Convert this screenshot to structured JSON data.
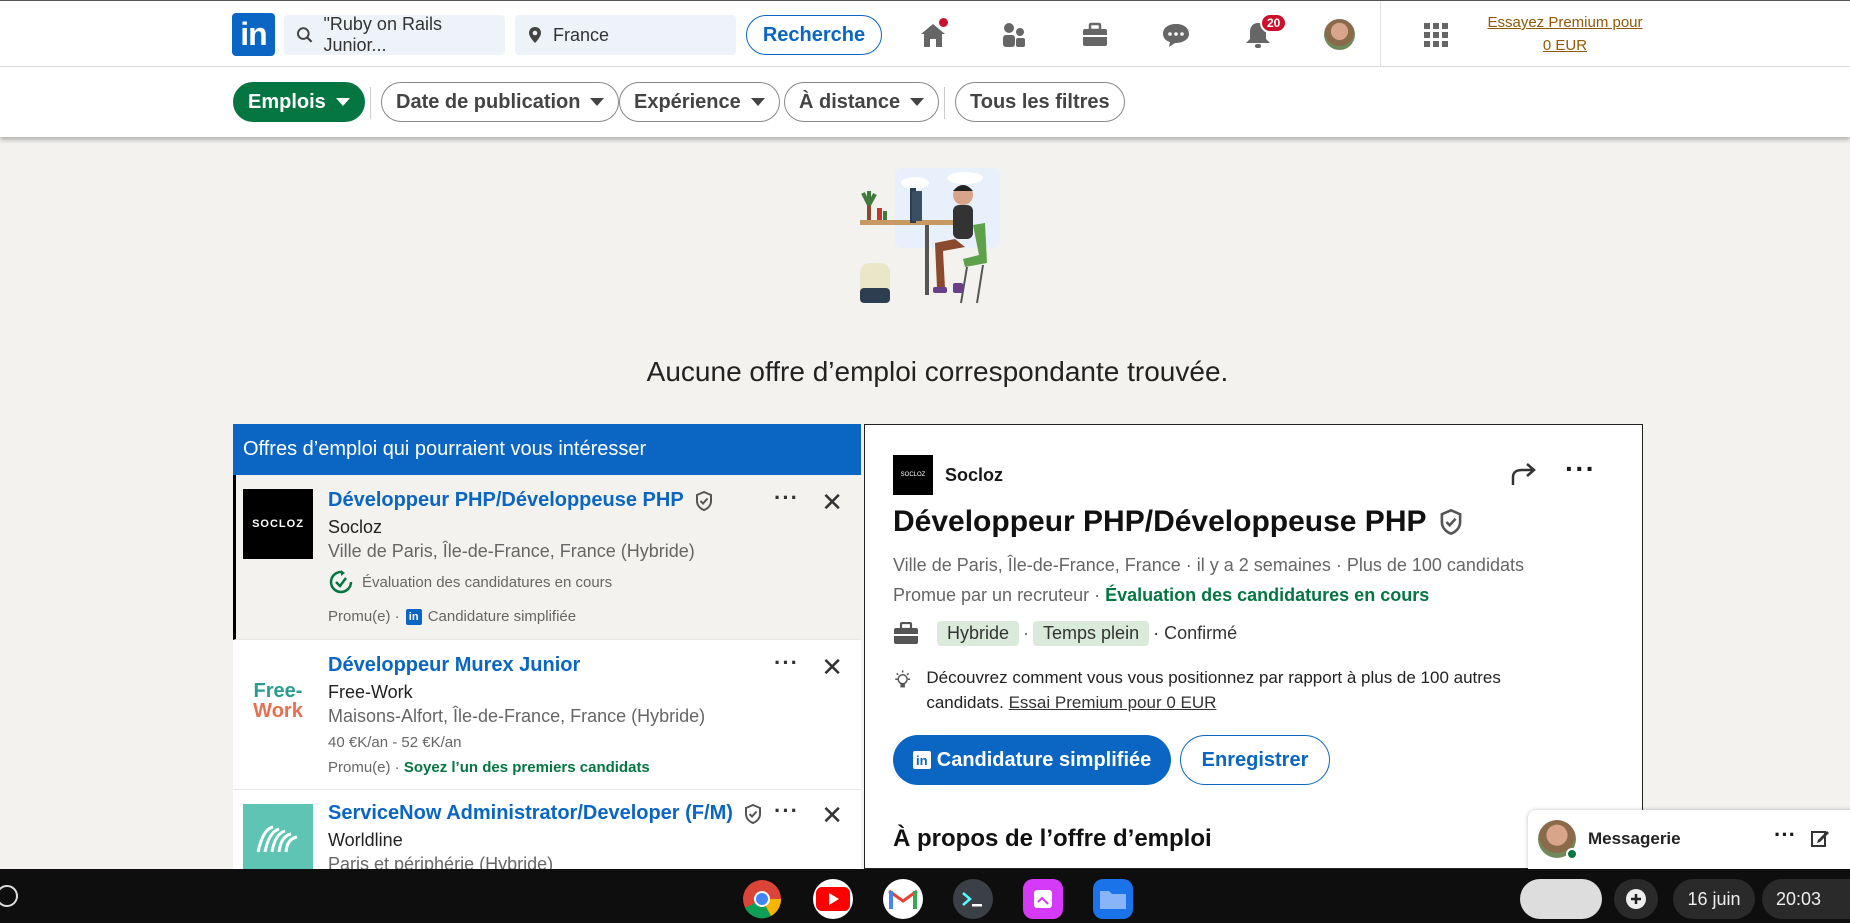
{
  "topbar": {
    "search_keywords": "\"Ruby on Rails Junior...",
    "search_location": "France",
    "search_button": "Recherche",
    "notifications_count": "20",
    "premium_line1": "Essayez Premium pour",
    "premium_line2": "0 EUR"
  },
  "filters": {
    "jobs": "Emplois",
    "date": "Date de publication",
    "experience": "Expérience",
    "remote": "À distance",
    "all": "Tous les filtres"
  },
  "empty_state": {
    "message": "Aucune offre d’emploi correspondante trouvée."
  },
  "list": {
    "header": "Offres d’emploi qui pourraient vous intéresser",
    "jobs": [
      {
        "title": "Développeur PHP/Développeuse PHP",
        "company": "Socloz",
        "location": "Ville de Paris, Île-de-France, France (Hybride)",
        "status": "Évaluation des candidatures en cours",
        "footer_promo": "Promu(e) ·",
        "footer_apply": "Candidature simplifiée",
        "logo_text": "SOCLOZ"
      },
      {
        "title": "Développeur Murex Junior",
        "company": "Free-Work",
        "location": "Maisons-Alfort, Île-de-France, France (Hybride)",
        "salary": "40 €K/an - 52 €K/an",
        "footer_promo": "Promu(e) ·",
        "footer_highlight": "Soyez l’un des premiers candidats",
        "logo_line1": "Free-",
        "logo_line2": "Work"
      },
      {
        "title": "ServiceNow Administrator/Developer (F/M)",
        "company": "Worldline",
        "location": "Paris et périphérie (Hybride)"
      }
    ]
  },
  "detail": {
    "company": "Socloz",
    "logo_text": "SOCLOZ",
    "title": "Développeur PHP/Développeuse PHP",
    "meta": "Ville de Paris, Île-de-France, France · il y a 2 semaines · Plus de 100 candidats",
    "promo": "Promue par un recruteur ·",
    "status": "Évaluation des candidatures en cours",
    "tag1": "Hybride",
    "tag2": "Temps plein",
    "level": "· Confirmé",
    "insight": "Découvrez comment vous vous positionnez par rapport à plus de 100 autres candidats.",
    "insight_link": "Essai Premium pour 0 EUR",
    "apply_button": "Candidature simplifiée",
    "save_button": "Enregistrer",
    "about_heading": "À propos de l’offre d’emploi"
  },
  "messaging": {
    "label": "Messagerie"
  },
  "taskbar": {
    "date": "16 juin",
    "time": "20:03"
  }
}
